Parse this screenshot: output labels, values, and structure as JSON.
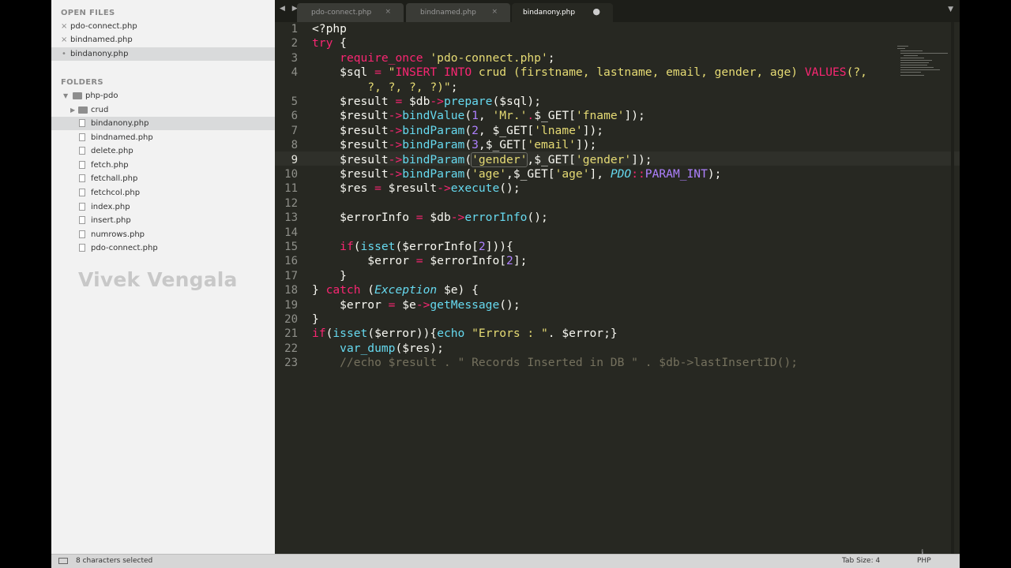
{
  "sidebar": {
    "open_files_title": "OPEN FILES",
    "open_files": [
      {
        "label": "pdo-connect.php",
        "marker": "×",
        "active": false
      },
      {
        "label": "bindnamed.php",
        "marker": "×",
        "active": false
      },
      {
        "label": "bindanony.php",
        "marker": "•",
        "active": true
      }
    ],
    "folders_title": "FOLDERS",
    "root_folder": "php-pdo",
    "subfolder": "crud",
    "files": [
      "bindanony.php",
      "bindnamed.php",
      "delete.php",
      "fetch.php",
      "fetchall.php",
      "fetchcol.php",
      "index.php",
      "insert.php",
      "numrows.php",
      "pdo-connect.php"
    ],
    "active_file": "bindanony.php",
    "watermark": "Vivek Vengala"
  },
  "tabs": [
    {
      "label": "pdo-connect.php",
      "close": "×",
      "active": false
    },
    {
      "label": "bindnamed.php",
      "close": "×",
      "active": false
    },
    {
      "label": "bindanony.php",
      "close": "●",
      "active": true
    }
  ],
  "nav_arrows": "◀ ▶",
  "dropdown_glyph": "▼",
  "editor": {
    "current_line": "9",
    "line_numbers": [
      "1",
      "2",
      "3",
      "4",
      "",
      "5",
      "6",
      "7",
      "8",
      "9",
      "10",
      "11",
      "12",
      "13",
      "14",
      "15",
      "16",
      "17",
      "18",
      "19",
      "20",
      "21",
      "22",
      "23"
    ],
    "lines": [
      [
        {
          "t": "<?php",
          "c": ""
        }
      ],
      [
        {
          "t": "try",
          "c": "kw"
        },
        {
          "t": " {",
          "c": ""
        }
      ],
      [
        {
          "t": "    ",
          "c": ""
        },
        {
          "t": "require_once",
          "c": "kw"
        },
        {
          "t": " ",
          "c": ""
        },
        {
          "t": "'pdo-connect.php'",
          "c": "str"
        },
        {
          "t": ";",
          "c": ""
        }
      ],
      [
        {
          "t": "    $sql ",
          "c": ""
        },
        {
          "t": "=",
          "c": "kw"
        },
        {
          "t": " ",
          "c": ""
        },
        {
          "t": "\"",
          "c": "str"
        },
        {
          "t": "INSERT INTO",
          "c": "kw"
        },
        {
          "t": " crud (firstname, lastname, email, gender, age) ",
          "c": "str"
        },
        {
          "t": "VALUES",
          "c": "kw"
        },
        {
          "t": "(?,",
          "c": "str"
        }
      ],
      [
        {
          "t": "        ?, ?, ?, ?)\"",
          "c": "str"
        },
        {
          "t": ";",
          "c": ""
        }
      ],
      [
        {
          "t": "    $result ",
          "c": ""
        },
        {
          "t": "=",
          "c": "kw"
        },
        {
          "t": " $db",
          "c": ""
        },
        {
          "t": "->",
          "c": "kw"
        },
        {
          "t": "prepare",
          "c": "fn"
        },
        {
          "t": "($sql);",
          "c": ""
        }
      ],
      [
        {
          "t": "    $result",
          "c": ""
        },
        {
          "t": "->",
          "c": "kw"
        },
        {
          "t": "bindValue",
          "c": "fn"
        },
        {
          "t": "(",
          "c": ""
        },
        {
          "t": "1",
          "c": "num"
        },
        {
          "t": ", ",
          "c": ""
        },
        {
          "t": "'Mr.'",
          "c": "str"
        },
        {
          "t": ".",
          "c": "kw"
        },
        {
          "t": "$_GET[",
          "c": ""
        },
        {
          "t": "'fname'",
          "c": "str"
        },
        {
          "t": "]);",
          "c": ""
        }
      ],
      [
        {
          "t": "    $result",
          "c": ""
        },
        {
          "t": "->",
          "c": "kw"
        },
        {
          "t": "bindParam",
          "c": "fn"
        },
        {
          "t": "(",
          "c": ""
        },
        {
          "t": "2",
          "c": "num"
        },
        {
          "t": ", $_GET[",
          "c": ""
        },
        {
          "t": "'lname'",
          "c": "str"
        },
        {
          "t": "]);",
          "c": ""
        }
      ],
      [
        {
          "t": "    $result",
          "c": ""
        },
        {
          "t": "->",
          "c": "kw"
        },
        {
          "t": "bindParam",
          "c": "fn"
        },
        {
          "t": "(",
          "c": ""
        },
        {
          "t": "3",
          "c": "num"
        },
        {
          "t": ",$_GET[",
          "c": ""
        },
        {
          "t": "'email'",
          "c": "str"
        },
        {
          "t": "]);",
          "c": ""
        }
      ],
      [
        {
          "t": "    $result",
          "c": ""
        },
        {
          "t": "->",
          "c": "kw"
        },
        {
          "t": "bindParam",
          "c": "fn"
        },
        {
          "t": "(",
          "c": ""
        },
        {
          "t": "'gender'",
          "c": "str hl"
        },
        {
          "t": ",$_GET[",
          "c": ""
        },
        {
          "t": "'gender'",
          "c": "str"
        },
        {
          "t": "]);",
          "c": ""
        }
      ],
      [
        {
          "t": "    $result",
          "c": ""
        },
        {
          "t": "->",
          "c": "kw"
        },
        {
          "t": "bindParam",
          "c": "fn"
        },
        {
          "t": "(",
          "c": ""
        },
        {
          "t": "'age'",
          "c": "str"
        },
        {
          "t": ",$_GET[",
          "c": ""
        },
        {
          "t": "'age'",
          "c": "str"
        },
        {
          "t": "], ",
          "c": ""
        },
        {
          "t": "PDO",
          "c": "ty"
        },
        {
          "t": "::",
          "c": "kw"
        },
        {
          "t": "PARAM_INT",
          "c": "num"
        },
        {
          "t": ");",
          "c": ""
        }
      ],
      [
        {
          "t": "    $res ",
          "c": ""
        },
        {
          "t": "=",
          "c": "kw"
        },
        {
          "t": " $result",
          "c": ""
        },
        {
          "t": "->",
          "c": "kw"
        },
        {
          "t": "execute",
          "c": "fn"
        },
        {
          "t": "();",
          "c": ""
        }
      ],
      [
        {
          "t": "",
          "c": ""
        }
      ],
      [
        {
          "t": "    $errorInfo ",
          "c": ""
        },
        {
          "t": "=",
          "c": "kw"
        },
        {
          "t": " $db",
          "c": ""
        },
        {
          "t": "->",
          "c": "kw"
        },
        {
          "t": "errorInfo",
          "c": "fn"
        },
        {
          "t": "();",
          "c": ""
        }
      ],
      [
        {
          "t": "",
          "c": ""
        }
      ],
      [
        {
          "t": "    ",
          "c": ""
        },
        {
          "t": "if",
          "c": "kw"
        },
        {
          "t": "(",
          "c": ""
        },
        {
          "t": "isset",
          "c": "fn"
        },
        {
          "t": "($errorInfo[",
          "c": ""
        },
        {
          "t": "2",
          "c": "num"
        },
        {
          "t": "])){",
          "c": ""
        }
      ],
      [
        {
          "t": "        $error ",
          "c": ""
        },
        {
          "t": "=",
          "c": "kw"
        },
        {
          "t": " $errorInfo[",
          "c": ""
        },
        {
          "t": "2",
          "c": "num"
        },
        {
          "t": "];",
          "c": ""
        }
      ],
      [
        {
          "t": "    }",
          "c": ""
        }
      ],
      [
        {
          "t": "} ",
          "c": ""
        },
        {
          "t": "catch",
          "c": "kw"
        },
        {
          "t": " (",
          "c": ""
        },
        {
          "t": "Exception",
          "c": "ty"
        },
        {
          "t": " $e) {",
          "c": ""
        }
      ],
      [
        {
          "t": "    $error ",
          "c": ""
        },
        {
          "t": "=",
          "c": "kw"
        },
        {
          "t": " $e",
          "c": ""
        },
        {
          "t": "->",
          "c": "kw"
        },
        {
          "t": "getMessage",
          "c": "fn"
        },
        {
          "t": "();",
          "c": ""
        }
      ],
      [
        {
          "t": "}",
          "c": ""
        }
      ],
      [
        {
          "t": "if",
          "c": "kw"
        },
        {
          "t": "(",
          "c": ""
        },
        {
          "t": "isset",
          "c": "fn"
        },
        {
          "t": "($error)){",
          "c": ""
        },
        {
          "t": "echo",
          "c": "fn"
        },
        {
          "t": " ",
          "c": ""
        },
        {
          "t": "\"Errors : \"",
          "c": "str"
        },
        {
          "t": ". $error;}",
          "c": ""
        }
      ],
      [
        {
          "t": "    ",
          "c": ""
        },
        {
          "t": "var_dump",
          "c": "fn"
        },
        {
          "t": "($res);",
          "c": ""
        }
      ],
      [
        {
          "t": "    //echo $result . \" Records Inserted in DB \" . $db->lastInsertID();",
          "c": "cm"
        }
      ]
    ]
  },
  "status": {
    "selection": "8 characters selected",
    "tab_size": "Tab Size: 4",
    "syntax": "PHP"
  },
  "colors": {
    "editor_bg": "#272822",
    "keyword": "#f92672",
    "string": "#e6db74",
    "function": "#66d9ef",
    "number": "#ae81ff",
    "comment": "#75715e"
  }
}
